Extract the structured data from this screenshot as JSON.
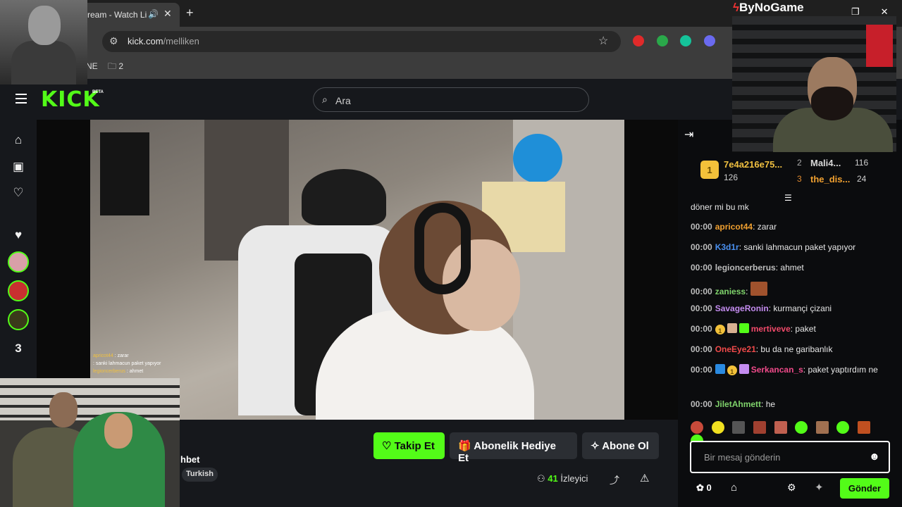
{
  "browser": {
    "tab_title": "ream - Watch Li",
    "new_tab": "+",
    "url_host": "kick.com",
    "url_path": "/melliken",
    "bookmarks": {
      "ne": "NE",
      "folder_count": "2"
    }
  },
  "header": {
    "logo": "KICK",
    "beta": "BETA",
    "search_placeholder": "Ara"
  },
  "sidebar": {
    "icons": [
      "home-icon",
      "browse-icon",
      "following-icon",
      "heart-icon"
    ],
    "avatars": 4,
    "third_icon_text": "3"
  },
  "video_overlay_chat": [
    {
      "user": "apricot44",
      "text": "zarar"
    },
    {
      "user": "",
      "text": "sanki lahmacun paket yapıyor"
    },
    {
      "user": "legioncerberus",
      "text": "ahmet"
    }
  ],
  "channel": {
    "title_fragment": "hbet",
    "language": "Turkish",
    "viewers_count": "41",
    "viewers_label": "İzleyici",
    "buttons": {
      "follow": "Takip Et",
      "gift": "Abonelik Hediye Et",
      "subscribe": "Abone Ol"
    }
  },
  "chat": {
    "leaderboard": [
      {
        "rank": "1",
        "name": "7e4a216e75...",
        "count": "126"
      },
      {
        "rank": "2",
        "name": "Mali4...",
        "count": "116"
      },
      {
        "rank": "3",
        "name": "the_dis...",
        "count": "24"
      }
    ],
    "messages": [
      {
        "time": "",
        "user": "",
        "text": "döner mi bu mk",
        "color": "#e6e6e6"
      },
      {
        "time": "00:00",
        "user": "apricot44",
        "text": "zarar",
        "color": "#f0a030"
      },
      {
        "time": "00:00",
        "user": "K3d1r",
        "text": "sanki lahmacun paket yapıyor",
        "color": "#4a90f0"
      },
      {
        "time": "00:00",
        "user": "legioncerberus",
        "text": "ahmet",
        "color": "#bdbdbd"
      },
      {
        "time": "00:00",
        "user": "zaniess",
        "text": "",
        "color": "#7fd36b"
      },
      {
        "time": "00:00",
        "user": "SavageRonin",
        "text": "kurmançi çizani",
        "color": "#c48cf0"
      },
      {
        "time": "00:00",
        "user": "mertiveve",
        "text": "paket",
        "color": "#f04a6a"
      },
      {
        "time": "00:00",
        "user": "OneEye21",
        "text": "bu da ne garibanlık",
        "color": "#f04a4a"
      },
      {
        "time": "00:00",
        "user": "Serkancan_s",
        "text": "paket yaptırdım ne",
        "color": "#f04a8a"
      },
      {
        "time": "00:00",
        "user": "JiletAhmett",
        "text": "he",
        "color": "#7fd36b"
      }
    ],
    "input_placeholder": "Bir mesaj gönderin",
    "points": "0",
    "send_label": "Gönder"
  },
  "overlay": {
    "brand": "ByNoGame"
  },
  "colors": {
    "accent": "#53fc18",
    "background": "#0b0c0e",
    "panel": "#16181c"
  }
}
